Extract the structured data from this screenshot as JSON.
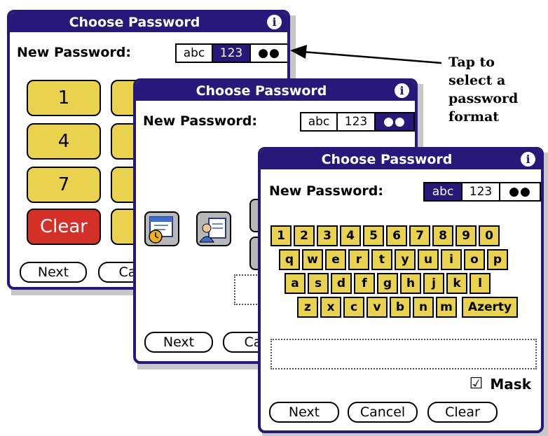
{
  "dialog_back": {
    "title": "Choose Password",
    "info_icon": "info-icon",
    "new_password_label": "New Password:",
    "format": {
      "abc": "abc",
      "num": "123",
      "mask": "●●",
      "selected": "123"
    },
    "keypad": {
      "k1": "1",
      "k4": "4",
      "k7": "7",
      "clear": "Clear"
    },
    "buttons": {
      "next": "Next",
      "cancel": "Can"
    }
  },
  "dialog_middle": {
    "title": "Choose Password",
    "info_icon": "info-icon",
    "new_password_label": "New Password:",
    "format": {
      "abc": "abc",
      "num": "123",
      "mask": "●●",
      "selected": "●●"
    },
    "icons": [
      "calendar-clock-icon",
      "contact-card-icon"
    ],
    "buttons": {
      "next": "Next",
      "cancel": "Can"
    }
  },
  "dialog_front": {
    "title": "Choose Password",
    "info_icon": "info-icon",
    "new_password_label": "New Password:",
    "format": {
      "abc": "abc",
      "num": "123",
      "mask": "●●",
      "selected": "abc"
    },
    "keyboard": {
      "row1": [
        "1",
        "2",
        "3",
        "4",
        "5",
        "6",
        "7",
        "8",
        "9",
        "0"
      ],
      "row2": [
        "q",
        "w",
        "e",
        "r",
        "t",
        "y",
        "u",
        "i",
        "o",
        "p"
      ],
      "row3": [
        "a",
        "s",
        "d",
        "f",
        "g",
        "h",
        "j",
        "k",
        "l"
      ],
      "row4": [
        "z",
        "x",
        "c",
        "v",
        "b",
        "n",
        "m"
      ],
      "layout_key": "Azerty"
    },
    "password_value": "",
    "mask": {
      "label": "Mask",
      "checked": true,
      "check_glyph": "☑"
    },
    "buttons": {
      "next": "Next",
      "cancel": "Cancel",
      "clear": "Clear"
    }
  },
  "callout": {
    "lines": [
      "Tap to",
      "select a",
      "password",
      "format"
    ]
  },
  "colors": {
    "title_bar": "#27187a",
    "key_yellow": "#e9d34e",
    "key_red": "#d43028"
  }
}
